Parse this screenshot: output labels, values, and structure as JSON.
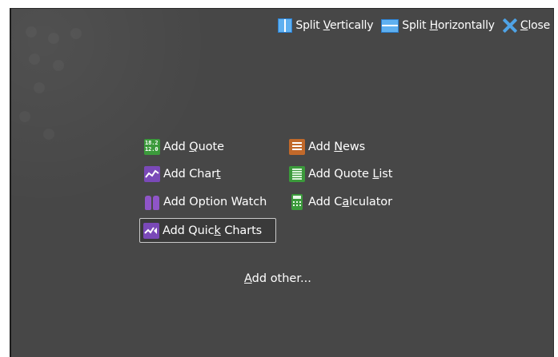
{
  "toolbar": {
    "split_vertically": {
      "pre": "Split ",
      "key": "V",
      "post": "ertically"
    },
    "split_horizontally": {
      "pre": "Split ",
      "key": "H",
      "post": "orizontally"
    },
    "close": {
      "pre": "",
      "key": "C",
      "post": "lose"
    }
  },
  "items": {
    "add_quote": {
      "pre": "Add ",
      "key": "Q",
      "post": "uote",
      "icon": "quote-grid-icon"
    },
    "add_news": {
      "pre": "Add ",
      "key": "N",
      "post": "ews",
      "icon": "news-icon"
    },
    "add_chart": {
      "pre": "Add Char",
      "key": "t",
      "post": "",
      "icon": "line-chart-icon"
    },
    "add_quote_list": {
      "pre": "Add Quote ",
      "key": "L",
      "post": "ist",
      "icon": "list-icon"
    },
    "add_option_watch": {
      "pre": "Add Option Watch",
      "key": "",
      "post": "",
      "icon": "binoculars-icon"
    },
    "add_calculator": {
      "pre": "Add C",
      "key": "a",
      "post": "lculator",
      "icon": "calculator-icon"
    },
    "add_quick_charts": {
      "pre": "Add Quic",
      "key": "k",
      "post": " Charts",
      "icon": "quick-charts-icon"
    }
  },
  "add_other": {
    "pre": "",
    "key": "A",
    "post": "dd other..."
  },
  "colors": {
    "panel_bg": "#474747",
    "green_icon": "#3b9a3b",
    "purple_icon": "#7a49b8",
    "orange_icon": "#c2692a",
    "blue_icon": "#5fb0f0"
  }
}
